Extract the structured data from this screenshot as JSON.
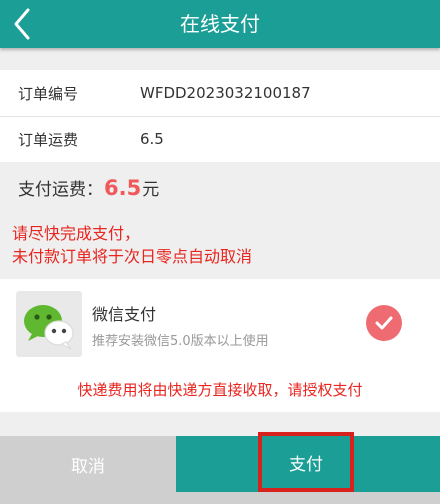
{
  "header": {
    "title": "在线支付",
    "back_icon": "chevron-left-icon"
  },
  "order": {
    "number_label": "订单编号",
    "number_value": "WFDD2023032100187",
    "fee_label": "订单运费",
    "fee_value": "6.5"
  },
  "payment_fee": {
    "label": "支付运费：",
    "amount": "6.5",
    "unit": "元"
  },
  "warning": {
    "line1": "请尽快完成支付，",
    "line2": "未付款订单将于次日零点自动取消"
  },
  "method": {
    "name": "微信支付",
    "desc": "推荐安装微信5.0版本以上使用",
    "icon": "wechat-icon",
    "selected": true
  },
  "notice": "快递费用将由快递方直接收取，请授权支付",
  "actions": {
    "cancel_label": "取消",
    "pay_label": "支付"
  },
  "colors": {
    "primary": "#1a9e95",
    "accent_red": "#e8251f",
    "amount": "#f0585a",
    "check": "#ef6b72"
  }
}
